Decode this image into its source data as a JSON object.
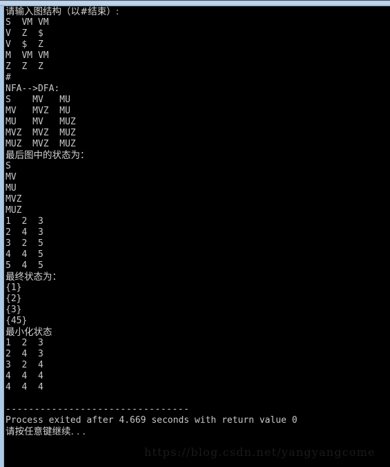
{
  "window": {
    "chrome_color": "#aecbe5",
    "background_color": "#000000",
    "text_color": "#c8c8c8"
  },
  "console": {
    "lines": [
      {
        "id": "prompt-input-graph",
        "text": "请输入图结构（以#结束）:",
        "cjk": true
      },
      {
        "id": "edge-1",
        "text": "S  VM VM",
        "cjk": false
      },
      {
        "id": "edge-2",
        "text": "V  Z  $",
        "cjk": false
      },
      {
        "id": "edge-3",
        "text": "V  $  Z",
        "cjk": false
      },
      {
        "id": "edge-4",
        "text": "M  VM VM",
        "cjk": false
      },
      {
        "id": "edge-5",
        "text": "Z  Z  Z",
        "cjk": false
      },
      {
        "id": "edge-terminator",
        "text": "#",
        "cjk": false
      },
      {
        "id": "header-nfa-dfa",
        "text": "NFA-->DFA:",
        "cjk": false
      },
      {
        "id": "dfa-row-1",
        "text": "S    MV   MU",
        "cjk": false
      },
      {
        "id": "dfa-row-2",
        "text": "MV   MVZ  MU",
        "cjk": false
      },
      {
        "id": "dfa-row-3",
        "text": "MU   MV   MUZ",
        "cjk": false
      },
      {
        "id": "dfa-row-4",
        "text": "MVZ  MVZ  MUZ",
        "cjk": false
      },
      {
        "id": "dfa-row-5",
        "text": "MUZ  MVZ  MUZ",
        "cjk": false
      },
      {
        "id": "header-final-graph-states",
        "text": "最后图中的状态为：",
        "cjk": true
      },
      {
        "id": "graph-state-1",
        "text": "S",
        "cjk": false
      },
      {
        "id": "graph-state-2",
        "text": "MV",
        "cjk": false
      },
      {
        "id": "graph-state-3",
        "text": "MU",
        "cjk": false
      },
      {
        "id": "graph-state-4",
        "text": "MVZ",
        "cjk": false
      },
      {
        "id": "graph-state-5",
        "text": "MUZ",
        "cjk": false
      },
      {
        "id": "numbered-row-1",
        "text": "1  2  3",
        "cjk": false
      },
      {
        "id": "numbered-row-2",
        "text": "2  4  3",
        "cjk": false
      },
      {
        "id": "numbered-row-3",
        "text": "3  2  5",
        "cjk": false
      },
      {
        "id": "numbered-row-4",
        "text": "4  4  5",
        "cjk": false
      },
      {
        "id": "numbered-row-5",
        "text": "5  4  5",
        "cjk": false
      },
      {
        "id": "header-final-states",
        "text": "最终状态为：",
        "cjk": true
      },
      {
        "id": "final-state-1",
        "text": "{1}",
        "cjk": false
      },
      {
        "id": "final-state-2",
        "text": "{2}",
        "cjk": false
      },
      {
        "id": "final-state-3",
        "text": "{3}",
        "cjk": false
      },
      {
        "id": "final-state-4",
        "text": "{45}",
        "cjk": false
      },
      {
        "id": "header-minimized-states",
        "text": "最小化状态",
        "cjk": true
      },
      {
        "id": "min-row-1",
        "text": "1  2  3",
        "cjk": false
      },
      {
        "id": "min-row-2",
        "text": "2  4  3",
        "cjk": false
      },
      {
        "id": "min-row-3",
        "text": "3  2  4",
        "cjk": false
      },
      {
        "id": "min-row-4",
        "text": "4  4  4",
        "cjk": false
      },
      {
        "id": "min-row-5",
        "text": "4  4  4",
        "cjk": false
      },
      {
        "id": "spacer-1",
        "text": " ",
        "cjk": false
      },
      {
        "id": "separator-rule",
        "text": "--------------------------------",
        "cjk": false
      },
      {
        "id": "process-exit-message",
        "text": "Process exited after 4.669 seconds with return value 0",
        "cjk": false
      },
      {
        "id": "press-any-key-message",
        "text": "请按任意键继续. . .",
        "cjk": true
      }
    ]
  },
  "watermark": {
    "text": "https://blog.csdn.net/yangyangcome"
  }
}
